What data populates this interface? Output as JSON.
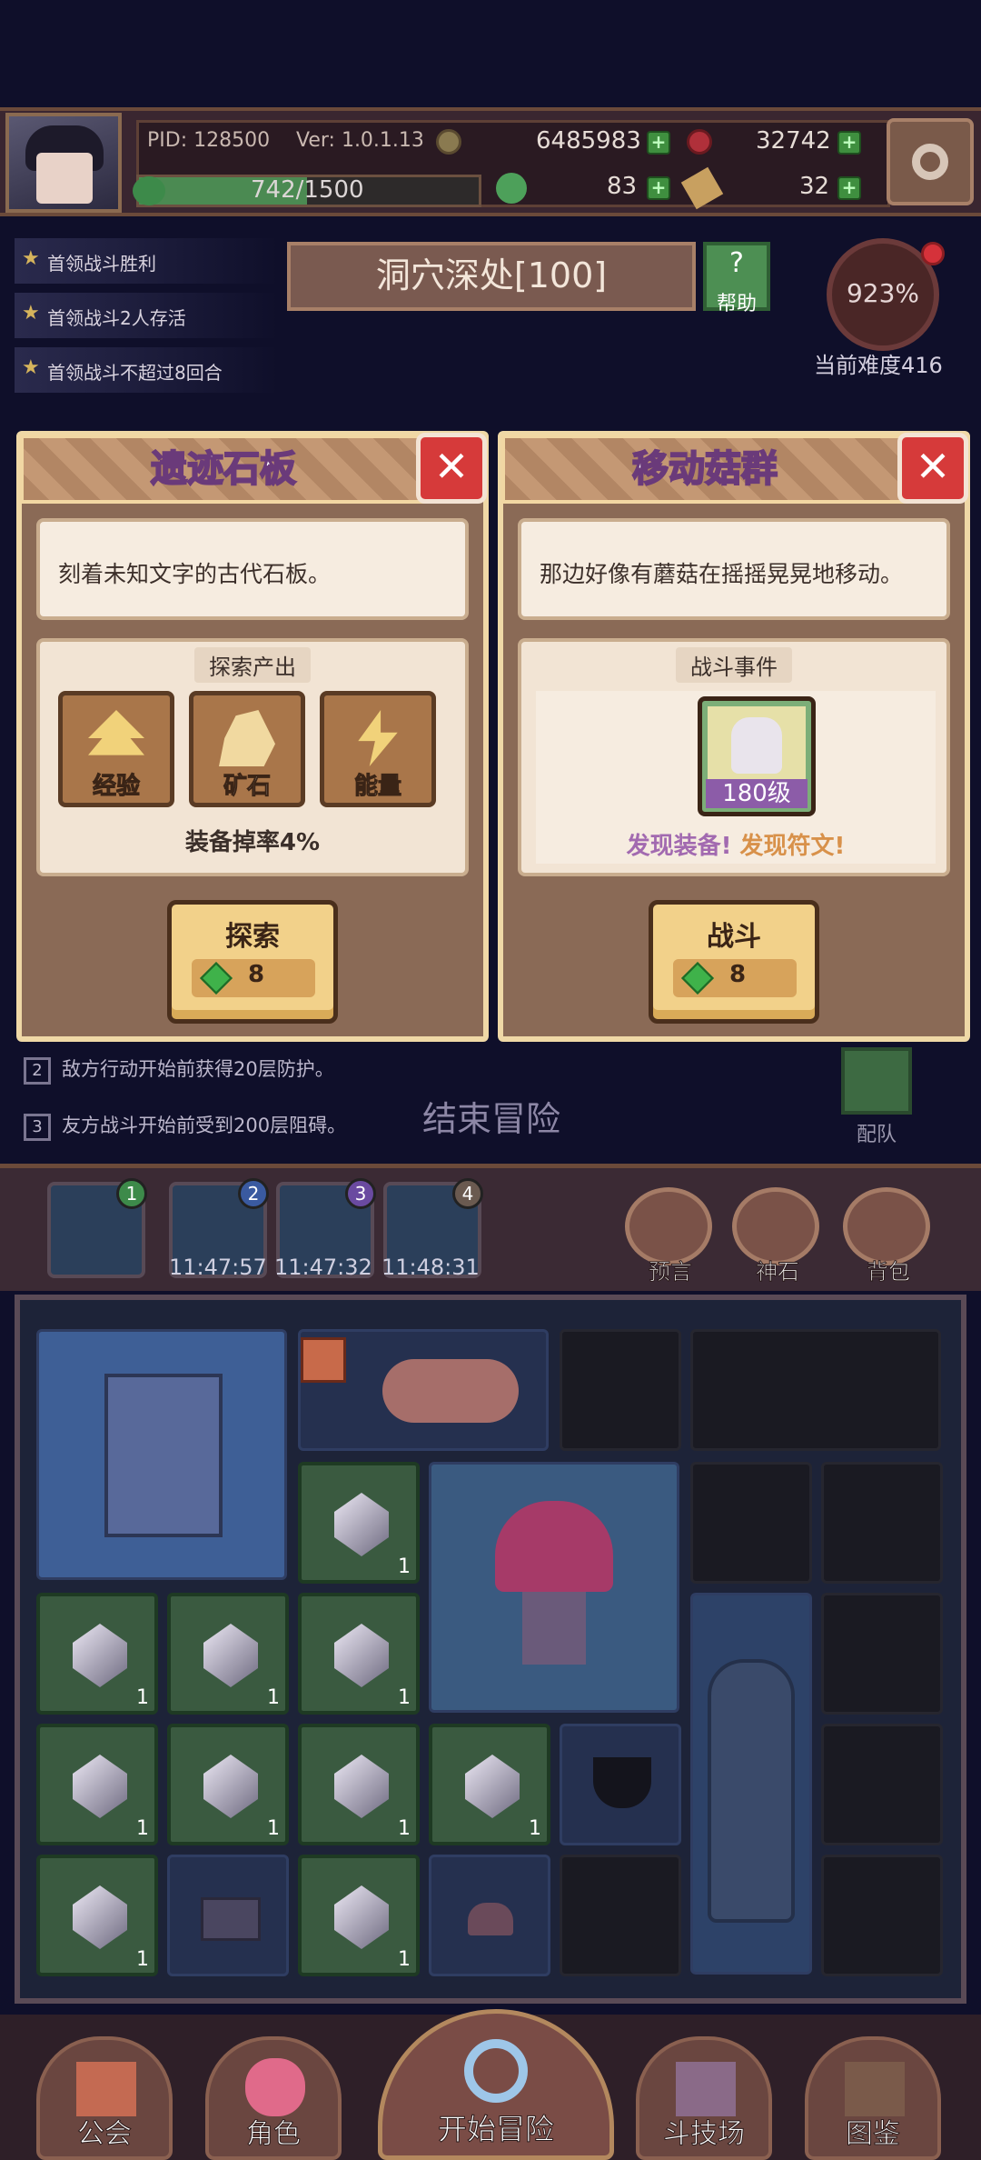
{
  "header": {
    "pid": "PID: 128500",
    "version": "Ver: 1.0.1.13",
    "gold": "6485983",
    "gems": "32742",
    "exp": "742/1500",
    "exp_progress": 0.4947,
    "clover": "83",
    "keys": "32"
  },
  "quests": [
    "首领战斗胜利",
    "首领战斗2人存活",
    "首领战斗不超过8回合"
  ],
  "level": {
    "title": "洞穴深处[100]",
    "help": "帮助",
    "difficulty_pct": "923%",
    "difficulty_label": "当前难度416"
  },
  "card_left": {
    "title": "遗迹石板",
    "desc": "刻着未知文字的古代石板。",
    "panel_label": "探索产出",
    "rewards": [
      "经验",
      "矿石",
      "能量"
    ],
    "drop": "装备掉率4%",
    "button": "探索",
    "cost": "8"
  },
  "card_right": {
    "title": "移动菇群",
    "desc": "那边好像有蘑菇在摇摇晃晃地移动。",
    "panel_label": "战斗事件",
    "level": "180级",
    "find_equip": "发现装备!",
    "find_rune": "发现符文!",
    "button": "战斗",
    "cost": "8"
  },
  "rules": [
    {
      "n": "2",
      "text": "敌方行动开始前获得20层防护。"
    },
    {
      "n": "3",
      "text": "友方战斗开始前受到200层阻碍。"
    }
  ],
  "end_adventure": "结束冒险",
  "team": "配队",
  "slots": [
    {
      "n": "1",
      "timer": ""
    },
    {
      "n": "2",
      "timer": "11:47:57"
    },
    {
      "n": "3",
      "timer": "11:47:32"
    },
    {
      "n": "4",
      "timer": "11:48:31"
    }
  ],
  "tools": [
    "预言",
    "神石",
    "背包"
  ],
  "ore_count": "1",
  "nav": [
    "公会",
    "角色",
    "开始冒险",
    "斗技场",
    "图鉴"
  ],
  "colors": {
    "accent_gold": "#efd8a6",
    "gem_green": "#3fb24a",
    "close_red": "#d63a3a",
    "title_purple": "#6a3a7a"
  }
}
